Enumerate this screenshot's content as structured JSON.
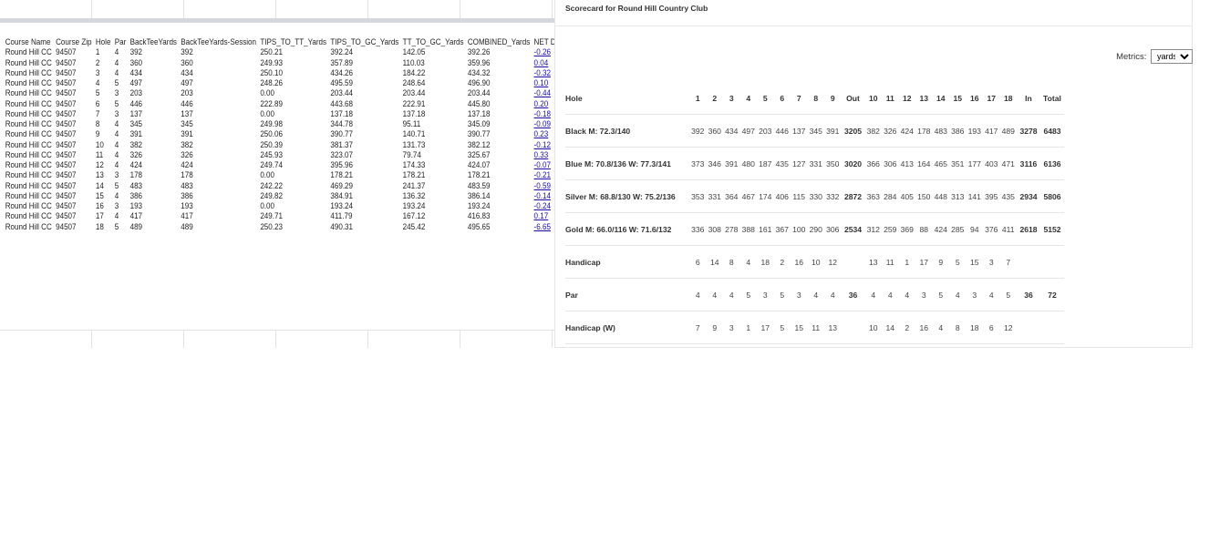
{
  "sheet": {
    "headers": [
      "Course Name",
      "Course Zip",
      "Hole",
      "Par",
      "BackTeeYards",
      "BackTeeYards-Session",
      "TIPS_TO_TT_Yards",
      "TIPS_TO_GC_Yards",
      "TT_TO_GC_Yards",
      "COMBINED_Yards",
      "NET DIFFERENCE"
    ],
    "rows": [
      [
        "Round Hill CC",
        "94507",
        "1",
        "4",
        "392",
        "392",
        "250.21",
        "392.24",
        "142.05",
        "392.26",
        "-0.26"
      ],
      [
        "Round Hill CC",
        "94507",
        "2",
        "4",
        "360",
        "360",
        "249.93",
        "357.89",
        "110.03",
        "359.96",
        "0.04"
      ],
      [
        "Round Hill CC",
        "94507",
        "3",
        "4",
        "434",
        "434",
        "250.10",
        "434.26",
        "184.22",
        "434.32",
        "-0.32"
      ],
      [
        "Round Hill CC",
        "94507",
        "4",
        "5",
        "497",
        "497",
        "248.26",
        "495.59",
        "248.64",
        "496.90",
        "0.10"
      ],
      [
        "Round Hill CC",
        "94507",
        "5",
        "3",
        "203",
        "203",
        "0.00",
        "203.44",
        "203.44",
        "203.44",
        "-0.44"
      ],
      [
        "Round Hill CC",
        "94507",
        "6",
        "5",
        "446",
        "446",
        "222.89",
        "443.68",
        "222.91",
        "445.80",
        "0.20"
      ],
      [
        "Round Hill CC",
        "94507",
        "7",
        "3",
        "137",
        "137",
        "0.00",
        "137.18",
        "137.18",
        "137.18",
        "-0.18"
      ],
      [
        "Round Hill CC",
        "94507",
        "8",
        "4",
        "345",
        "345",
        "249.98",
        "344.78",
        "95.11",
        "345.09",
        "-0.09"
      ],
      [
        "Round Hill CC",
        "94507",
        "9",
        "4",
        "391",
        "391",
        "250.06",
        "390.77",
        "140.71",
        "390.77",
        "0.23"
      ],
      [
        "Round Hill CC",
        "94507",
        "10",
        "4",
        "382",
        "382",
        "250.39",
        "381.37",
        "131.73",
        "382.12",
        "-0.12"
      ],
      [
        "Round Hill CC",
        "94507",
        "11",
        "4",
        "326",
        "326",
        "245.93",
        "323.07",
        "79.74",
        "325.67",
        "0.33"
      ],
      [
        "Round Hill CC",
        "94507",
        "12",
        "4",
        "424",
        "424",
        "249.74",
        "395.96",
        "174.33",
        "424.07",
        "-0.07"
      ],
      [
        "Round Hill CC",
        "94507",
        "13",
        "3",
        "178",
        "178",
        "0.00",
        "178.21",
        "178.21",
        "178.21",
        "-0.21"
      ],
      [
        "Round Hill CC",
        "94507",
        "14",
        "5",
        "483",
        "483",
        "242.22",
        "469.29",
        "241.37",
        "483.59",
        "-0.59"
      ],
      [
        "Round Hill CC",
        "94507",
        "15",
        "4",
        "386",
        "386",
        "249.82",
        "384.91",
        "136.32",
        "386.14",
        "-0.14"
      ],
      [
        "Round Hill CC",
        "94507",
        "16",
        "3",
        "193",
        "193",
        "0.00",
        "193.24",
        "193.24",
        "193.24",
        "-0.24"
      ],
      [
        "Round Hill CC",
        "94507",
        "17",
        "4",
        "417",
        "417",
        "249.71",
        "411.79",
        "167.12",
        "416.83",
        "0.17"
      ],
      [
        "Round Hill CC",
        "94507",
        "18",
        "5",
        "489",
        "489",
        "250.23",
        "490.31",
        "245.42",
        "495.65",
        "-6.65"
      ]
    ]
  },
  "scorecard": {
    "caption": "Scorecard for Round Hill Country Club",
    "metrics_label": "Metrics:",
    "metrics_value": "yards",
    "rows": [
      {
        "label": "Hole",
        "bold": true,
        "front": [
          "1",
          "2",
          "3",
          "4",
          "5",
          "6",
          "7",
          "8",
          "9"
        ],
        "out": "Out",
        "back": [
          "10",
          "11",
          "12",
          "13",
          "14",
          "15",
          "16",
          "17",
          "18"
        ],
        "in": "In",
        "total": "Total"
      },
      {
        "label": "Black M: 72.3/140",
        "front": [
          "392",
          "360",
          "434",
          "497",
          "203",
          "446",
          "137",
          "345",
          "391"
        ],
        "out": "3205",
        "back": [
          "382",
          "326",
          "424",
          "178",
          "483",
          "386",
          "193",
          "417",
          "489"
        ],
        "in": "3278",
        "total": "6483"
      },
      {
        "label": "Blue M: 70.8/136 W: 77.3/141",
        "front": [
          "373",
          "346",
          "391",
          "480",
          "187",
          "435",
          "127",
          "331",
          "350"
        ],
        "out": "3020",
        "back": [
          "366",
          "306",
          "413",
          "164",
          "465",
          "351",
          "177",
          "403",
          "471"
        ],
        "in": "3116",
        "total": "6136"
      },
      {
        "label": "Silver M: 68.8/130 W: 75.2/136",
        "front": [
          "353",
          "331",
          "364",
          "467",
          "174",
          "406",
          "115",
          "330",
          "332"
        ],
        "out": "2872",
        "back": [
          "363",
          "284",
          "405",
          "150",
          "448",
          "313",
          "141",
          "395",
          "435"
        ],
        "in": "2934",
        "total": "5806"
      },
      {
        "label": "Gold M: 66.0/116 W: 71.6/132",
        "front": [
          "336",
          "308",
          "278",
          "388",
          "161",
          "367",
          "100",
          "290",
          "306"
        ],
        "out": "2534",
        "back": [
          "312",
          "259",
          "369",
          "88",
          "424",
          "285",
          "94",
          "376",
          "411"
        ],
        "in": "2618",
        "total": "5152"
      },
      {
        "label": "Handicap",
        "front": [
          "6",
          "14",
          "8",
          "4",
          "18",
          "2",
          "16",
          "10",
          "12"
        ],
        "out": "",
        "back": [
          "13",
          "11",
          "1",
          "17",
          "9",
          "5",
          "15",
          "3",
          "7"
        ],
        "in": "",
        "total": ""
      },
      {
        "label": "Par",
        "front": [
          "4",
          "4",
          "4",
          "5",
          "3",
          "5",
          "3",
          "4",
          "4"
        ],
        "out": "36",
        "back": [
          "4",
          "4",
          "4",
          "3",
          "5",
          "4",
          "3",
          "4",
          "5"
        ],
        "in": "36",
        "total": "72"
      },
      {
        "label": "Handicap (W)",
        "front": [
          "7",
          "9",
          "3",
          "1",
          "17",
          "5",
          "15",
          "11",
          "13"
        ],
        "out": "",
        "back": [
          "10",
          "14",
          "2",
          "16",
          "4",
          "8",
          "18",
          "6",
          "12"
        ],
        "in": "",
        "total": ""
      }
    ]
  }
}
